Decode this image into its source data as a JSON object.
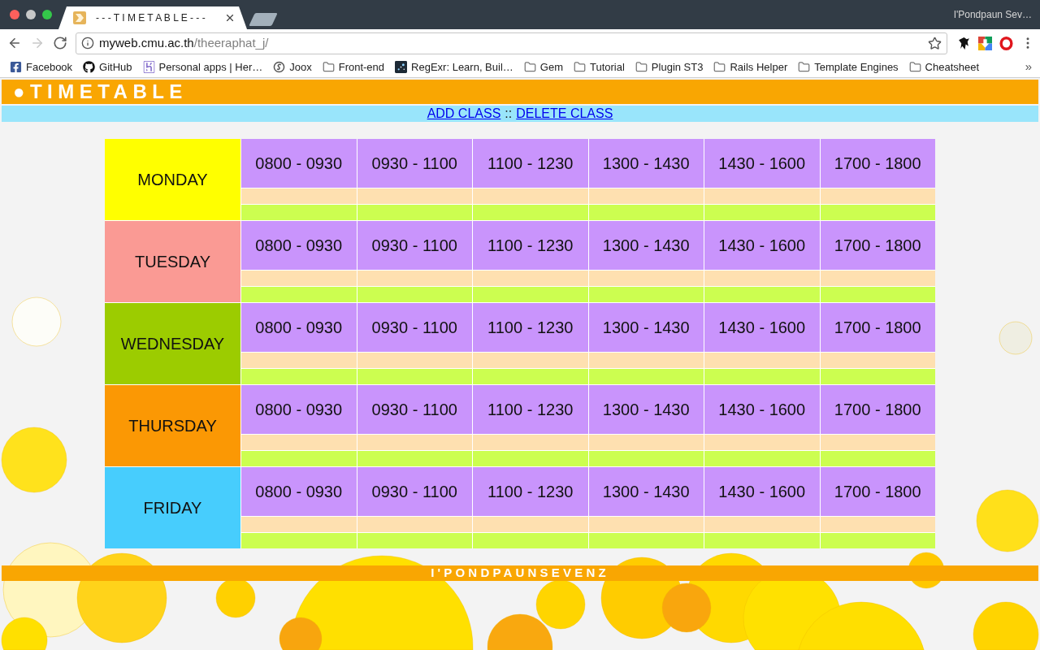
{
  "browser": {
    "tabs": [
      {
        "title": "- - - T I M E T A B L E - - -",
        "selected": true
      }
    ],
    "profile": "I'Pondpaun Sev…",
    "nav_buttons": [
      {
        "kind": "back",
        "disabled": false
      },
      {
        "kind": "forward",
        "disabled": true
      },
      {
        "kind": "reload",
        "disabled": false
      }
    ],
    "address": {
      "host": "myweb.cmu.ac.th",
      "path": "/theeraphat_j/"
    },
    "bookmarks": [
      {
        "label": "Facebook",
        "kind": "site"
      },
      {
        "label": "GitHub",
        "kind": "site"
      },
      {
        "label": "Personal apps | Her…",
        "kind": "site"
      },
      {
        "label": "Joox",
        "kind": "site"
      },
      {
        "label": "Front-end",
        "kind": "folder"
      },
      {
        "label": "RegExr: Learn, Buil…",
        "kind": "site"
      },
      {
        "label": "Gem",
        "kind": "folder"
      },
      {
        "label": "Tutorial",
        "kind": "folder"
      },
      {
        "label": "Plugin ST3",
        "kind": "folder"
      },
      {
        "label": "Rails Helper",
        "kind": "folder"
      },
      {
        "label": "Template Engines",
        "kind": "folder"
      },
      {
        "label": "Cheatsheet",
        "kind": "folder"
      }
    ],
    "bookmarks_overflow": "»"
  },
  "page": {
    "header": {
      "title": "●TIMETABLE"
    },
    "nav": {
      "links": [
        "ADD CLASS",
        "DELETE CLASS"
      ],
      "separator": "::"
    },
    "days": [
      {
        "name": "MONDAY",
        "color": "#ffff00",
        "slots": [
          "0800 - 0930",
          "0930 - 1100",
          "1100 - 1230",
          "1300 - 1430",
          "1430 - 1600",
          "1700 - 1800"
        ]
      },
      {
        "name": "TUESDAY",
        "color": "#fa9a94",
        "slots": [
          "0800 - 0930",
          "0930 - 1100",
          "1100 - 1230",
          "1300 - 1430",
          "1430 - 1600",
          "1700 - 1800"
        ]
      },
      {
        "name": "WEDNESDAY",
        "color": "#9ccc00",
        "slots": [
          "0800 - 0930",
          "0930 - 1100",
          "1100 - 1230",
          "1300 - 1430",
          "1430 - 1600",
          "1700 - 1800"
        ]
      },
      {
        "name": "THURSDAY",
        "color": "#fb9804",
        "slots": [
          "0800 - 0930",
          "0930 - 1100",
          "1100 - 1230",
          "1300 - 1430",
          "1430 - 1600",
          "1700 - 1800"
        ]
      },
      {
        "name": "FRIDAY",
        "color": "#47cdfd",
        "slots": [
          "0800 - 0930",
          "0930 - 1100",
          "1100 - 1230",
          "1300 - 1430",
          "1430 - 1600",
          "1700 - 1800"
        ]
      }
    ],
    "footer": "I'PONDPAUNSEVENZ"
  }
}
